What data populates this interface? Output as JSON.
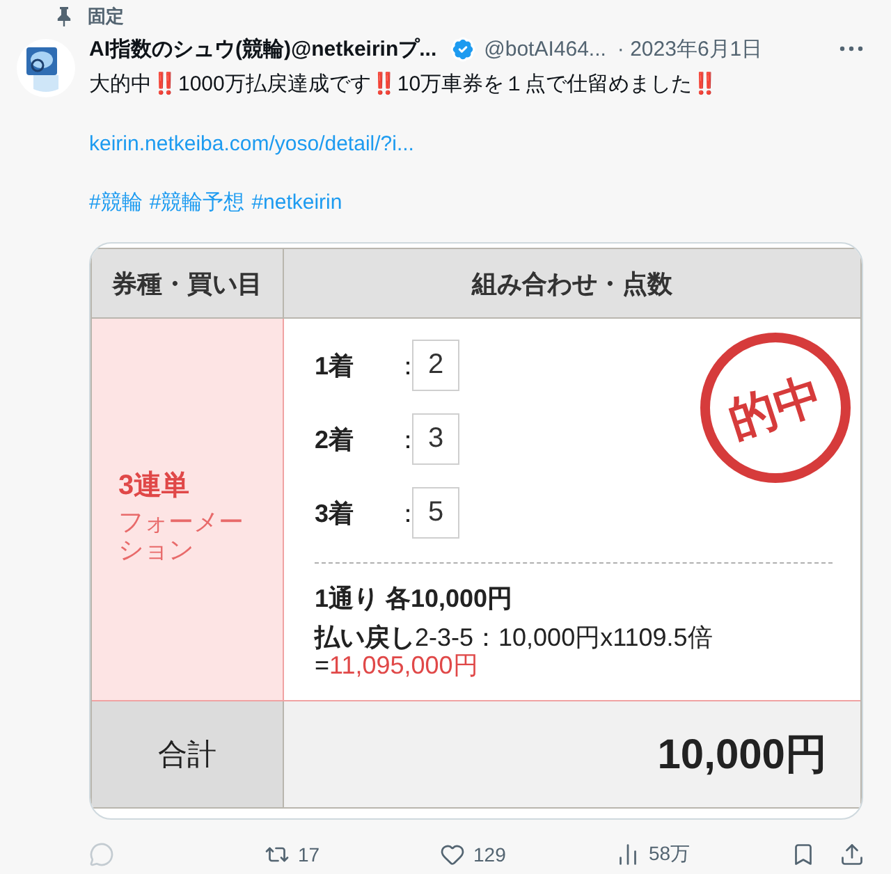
{
  "pin": {
    "label": "固定"
  },
  "author": {
    "name": "AI指数のシュウ(競輪)@netkeirinプ...",
    "verified": true,
    "handle": "@botAI464...",
    "date": "· 2023年6月1日"
  },
  "text": [
    {
      "kind": "text",
      "text": "大的中"
    },
    {
      "kind": "emoji",
      "text": "‼️"
    },
    {
      "kind": "text",
      "text": "1000万払戻達成です"
    },
    {
      "kind": "emoji",
      "text": "‼️"
    },
    {
      "kind": "text",
      "text": "10万車券を１点で仕留めました"
    },
    {
      "kind": "emoji",
      "text": "‼️"
    }
  ],
  "link": "keirin.netkeiba.com/yoso/detail/?i...",
  "hashtags": [
    "#競輪",
    "#競輪予想",
    "#netkeirin"
  ],
  "card": {
    "columns": [
      "券種・買い目",
      "組み合わせ・点数"
    ],
    "bet_type": {
      "name": "3連単",
      "method": "フォーメーション"
    },
    "placings": [
      {
        "label": "1着",
        "separator": "：",
        "value": "2"
      },
      {
        "label": "2着",
        "separator": "：",
        "value": "3"
      },
      {
        "label": "3着",
        "separator": "：",
        "value": "5"
      }
    ],
    "stamp": "的中",
    "combination": "1通り 各10,000円",
    "payout": {
      "label": "払い戻し",
      "detail": "2-3-5：10,000円x1109.5倍",
      "equals": "=",
      "amount": "11,095,000円"
    },
    "total": {
      "label": "合計",
      "value": "10,000円"
    }
  },
  "actions": [
    {
      "kind": "reply",
      "disabled": true
    },
    {
      "kind": "repost",
      "count": "17",
      "disabled": false
    },
    {
      "kind": "like",
      "count": "129",
      "disabled": false
    },
    {
      "kind": "views",
      "count": "58万",
      "disabled": false
    },
    {
      "kind": "bookmark",
      "disabled": false
    },
    {
      "kind": "share",
      "disabled": false
    }
  ]
}
